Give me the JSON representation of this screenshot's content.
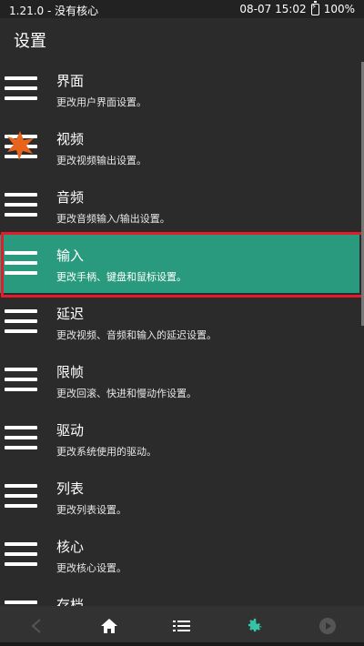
{
  "status_bar": {
    "left_text": "1.21.0 - 没有核心",
    "time": "08-07 15:02",
    "battery": "100%"
  },
  "header": {
    "title": "设置"
  },
  "settings_items": [
    {
      "label": "界面",
      "description": "更改用户界面设置。",
      "icon": "hamburger-icon"
    },
    {
      "label": "视频",
      "description": "更改视频输出设置。",
      "icon": "hamburger-icon"
    },
    {
      "label": "音频",
      "description": "更改音频输入/输出设置。",
      "icon": "hamburger-icon"
    },
    {
      "label": "输入",
      "description": "更改手柄、键盘和鼠标设置。",
      "icon": "hamburger-icon",
      "selected": true
    },
    {
      "label": "延迟",
      "description": "更改视频、音频和输入的延迟设置。",
      "icon": "hamburger-icon"
    },
    {
      "label": "限帧",
      "description": "更改回滚、快进和慢动作设置。",
      "icon": "hamburger-icon"
    },
    {
      "label": "驱动",
      "description": "更改系统使用的驱动。",
      "icon": "hamburger-icon"
    },
    {
      "label": "列表",
      "description": "更改列表设置。",
      "icon": "hamburger-icon"
    },
    {
      "label": "核心",
      "description": "更改核心设置。",
      "icon": "hamburger-icon"
    },
    {
      "label": "存档",
      "description": "",
      "icon": "hamburger-icon"
    }
  ],
  "bottom_nav": [
    {
      "icon": "back-icon"
    },
    {
      "icon": "home-icon"
    },
    {
      "icon": "list-icon"
    },
    {
      "icon": "settings-gear-icon",
      "active": true
    },
    {
      "icon": "play-icon"
    }
  ],
  "colors": {
    "background": "#2b2b2b",
    "selected_row": "#2a9a7e",
    "highlight_border": "#e21c2a",
    "accent": "#35c4a6"
  }
}
